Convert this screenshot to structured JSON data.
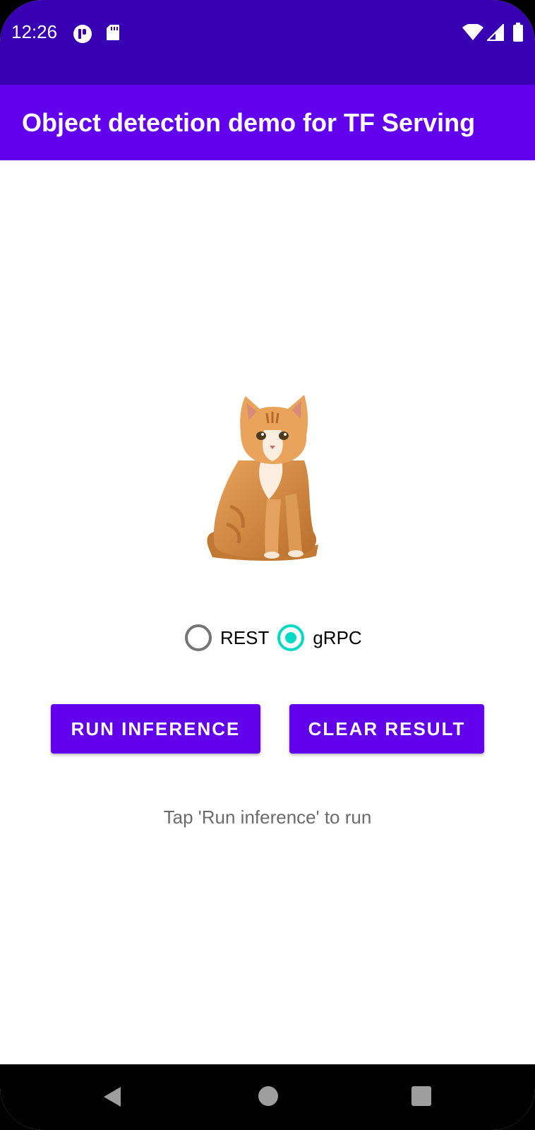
{
  "status_bar": {
    "time": "12:26",
    "left_icons": [
      "app-notification-icon",
      "sd-card-icon"
    ],
    "right_icons": [
      "wifi-icon",
      "signal-icon",
      "battery-icon"
    ]
  },
  "app_bar": {
    "title": "Object detection demo for TF Serving"
  },
  "main": {
    "image": "cat-image",
    "protocol": {
      "options": [
        {
          "label": "REST",
          "checked": false
        },
        {
          "label": "gRPC",
          "checked": true
        }
      ]
    },
    "buttons": {
      "run": "RUN INFERENCE",
      "clear": "CLEAR RESULT"
    },
    "result_text": "Tap 'Run inference' to run"
  },
  "nav_bar": {
    "buttons": [
      "back-icon",
      "home-icon",
      "recents-icon"
    ]
  },
  "colors": {
    "status_bar": "#3700B3",
    "primary": "#6200EE",
    "accent": "#03DAC5",
    "radio_unchecked": "#757575",
    "result_text": "#6B6B6B"
  }
}
